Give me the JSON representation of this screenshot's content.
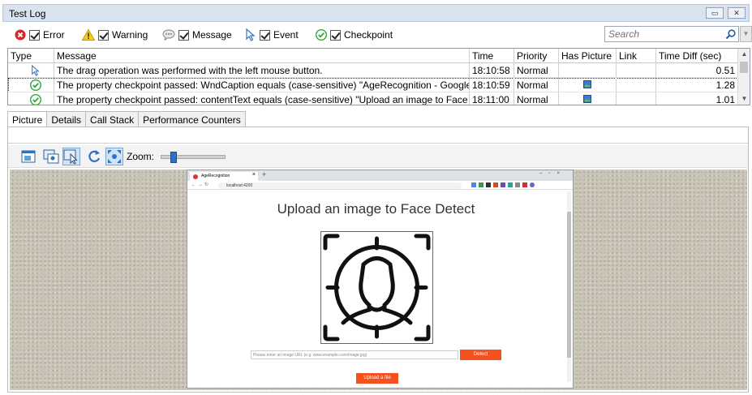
{
  "window": {
    "title": "Test Log"
  },
  "filters": [
    {
      "label": "Error",
      "icon": "error-icon",
      "checked": true
    },
    {
      "label": "Warning",
      "icon": "warning-icon",
      "checked": true
    },
    {
      "label": "Message",
      "icon": "message-icon",
      "checked": true
    },
    {
      "label": "Event",
      "icon": "event-icon",
      "checked": true
    },
    {
      "label": "Checkpoint",
      "icon": "checkpoint-icon",
      "checked": true
    }
  ],
  "search": {
    "placeholder": "Search"
  },
  "log_table": {
    "columns": [
      "Type",
      "Message",
      "Time",
      "Priority",
      "Has Picture",
      "Link",
      "Time Diff (sec)"
    ],
    "rows": [
      {
        "type": "event-icon",
        "message": "The drag operation was performed with the left mouse button.",
        "time": "18:10:58",
        "priority": "Normal",
        "has_picture": false,
        "link": "",
        "time_diff": "0.51"
      },
      {
        "type": "checkpoint-icon",
        "message": "The property checkpoint passed: WndCaption equals (case-sensitive) \"AgeRecognition - Google Chrom...",
        "time": "18:10:59",
        "priority": "Normal",
        "has_picture": true,
        "link": "",
        "time_diff": "1.28",
        "selected": true
      },
      {
        "type": "checkpoint-icon",
        "message": "The property checkpoint passed: contentText equals (case-sensitive) \"Upload an image to Face Detect\".",
        "time": "18:11:00",
        "priority": "Normal",
        "has_picture": true,
        "link": "",
        "time_diff": "1.01"
      }
    ]
  },
  "tabs": [
    "Picture",
    "Details",
    "Call Stack",
    "Performance Counters"
  ],
  "active_tab": "Picture",
  "picture_toolbar": {
    "zoom_label": "Zoom:",
    "zoom_level": 0.15
  },
  "screenshot": {
    "browser_tab": "AgeRecognition",
    "url": "localhost:4200",
    "heading": "Upload an image to Face Detect",
    "url_placeholder": "Please enter an image URL (e.g. www.example.com/image.jpg)",
    "detect_label": "Detect",
    "upload_label": "Upload a file"
  },
  "colors": {
    "accent": "#f4511e",
    "selection": "#cfe3f7",
    "check_green": "#2eaa3c",
    "error_red": "#d9262e"
  }
}
